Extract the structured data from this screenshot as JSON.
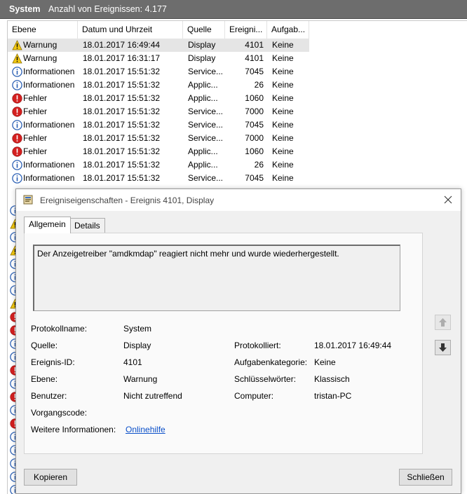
{
  "header": {
    "title": "System",
    "count": "Anzahl von Ereignissen: 4.177"
  },
  "columns": [
    "Ebene",
    "Datum und Uhrzeit",
    "Quelle",
    "Ereigni...",
    "Aufgab..."
  ],
  "rows": [
    {
      "icon": "warning-icon",
      "level": "Warnung",
      "date": "18.01.2017 16:49:44",
      "source": "Display",
      "id": "4101",
      "task": "Keine"
    },
    {
      "icon": "warning-icon",
      "level": "Warnung",
      "date": "18.01.2017 16:31:17",
      "source": "Display",
      "id": "4101",
      "task": "Keine"
    },
    {
      "icon": "info-icon",
      "level": "Informationen",
      "date": "18.01.2017 15:51:32",
      "source": "Service...",
      "id": "7045",
      "task": "Keine"
    },
    {
      "icon": "info-icon",
      "level": "Informationen",
      "date": "18.01.2017 15:51:32",
      "source": "Applic...",
      "id": "26",
      "task": "Keine"
    },
    {
      "icon": "error-icon",
      "level": "Fehler",
      "date": "18.01.2017 15:51:32",
      "source": "Applic...",
      "id": "1060",
      "task": "Keine"
    },
    {
      "icon": "error-icon",
      "level": "Fehler",
      "date": "18.01.2017 15:51:32",
      "source": "Service...",
      "id": "7000",
      "task": "Keine"
    },
    {
      "icon": "info-icon",
      "level": "Informationen",
      "date": "18.01.2017 15:51:32",
      "source": "Service...",
      "id": "7045",
      "task": "Keine"
    },
    {
      "icon": "error-icon",
      "level": "Fehler",
      "date": "18.01.2017 15:51:32",
      "source": "Service...",
      "id": "7000",
      "task": "Keine"
    },
    {
      "icon": "error-icon",
      "level": "Fehler",
      "date": "18.01.2017 15:51:32",
      "source": "Applic...",
      "id": "1060",
      "task": "Keine"
    },
    {
      "icon": "info-icon",
      "level": "Informationen",
      "date": "18.01.2017 15:51:32",
      "source": "Applic...",
      "id": "26",
      "task": "Keine"
    },
    {
      "icon": "info-icon",
      "level": "Informationen",
      "date": "18.01.2017 15:51:32",
      "source": "Service...",
      "id": "7045",
      "task": "Keine"
    }
  ],
  "peek_icons": [
    "info-icon",
    "warning-icon",
    "info-icon",
    "warning-icon",
    "info-icon",
    "info-icon",
    "info-icon",
    "warning-icon",
    "error-icon",
    "error-icon",
    "info-icon",
    "info-icon",
    "error-icon",
    "info-icon",
    "error-icon",
    "info-icon",
    "error-icon",
    "info-icon",
    "info-icon",
    "info-icon",
    "info-icon",
    "info-icon"
  ],
  "dialog": {
    "title": "Ereigniseigenschaften - Ereignis 4101, Display",
    "tabs": [
      "Allgemein",
      "Details"
    ],
    "description": "Der Anzeigetreiber \"amdkmdap\" reagiert nicht mehr und wurde wiederhergestellt.",
    "props": {
      "log_name_label": "Protokollname:",
      "log_name": "System",
      "source_label": "Quelle:",
      "source": "Display",
      "logged_label": "Protokolliert:",
      "logged": "18.01.2017 16:49:44",
      "event_id_label": "Ereignis-ID:",
      "event_id": "4101",
      "task_cat_label": "Aufgabenkategorie:",
      "task_cat": "Keine",
      "level_label": "Ebene:",
      "level": "Warnung",
      "keywords_label": "Schlüsselwörter:",
      "keywords": "Klassisch",
      "user_label": "Benutzer:",
      "user": "Nicht zutreffend",
      "computer_label": "Computer:",
      "computer": "tristan-PC",
      "opcode_label": "Vorgangscode:",
      "opcode": "",
      "more_info_label": "Weitere Informationen:",
      "more_info_link": "Onlinehilfe"
    },
    "buttons": {
      "copy": "Kopieren",
      "close": "Schließen"
    }
  },
  "colors": {
    "header_bg": "#6d6d6d",
    "selected_row": "#e5e5e5",
    "link": "#0a4fc9",
    "warning": "#f2c811",
    "info": "#2a5fb4",
    "error": "#d42020"
  }
}
